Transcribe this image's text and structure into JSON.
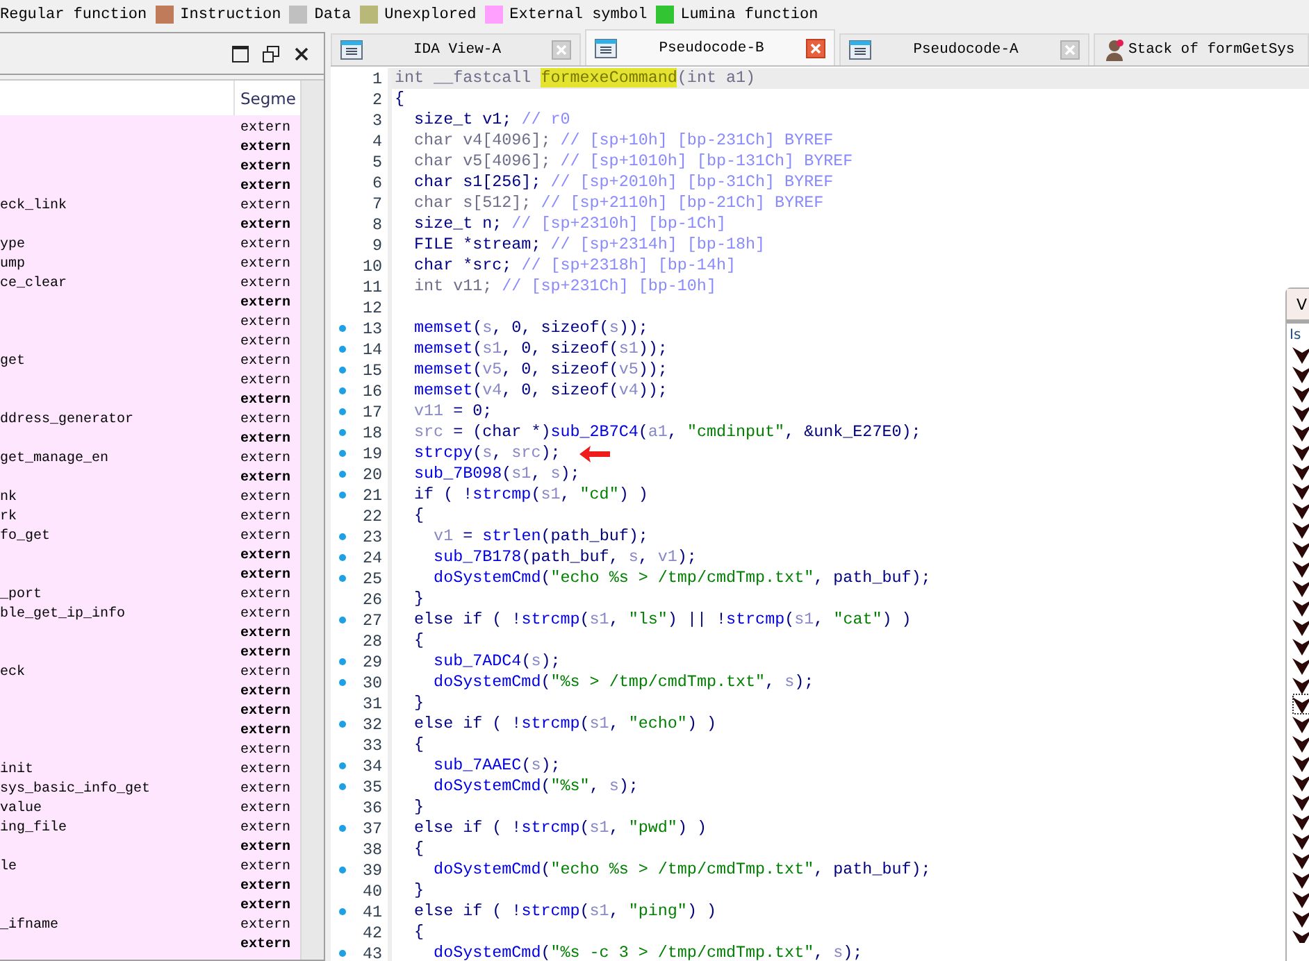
{
  "legend": [
    {
      "label": "Regular function"
    },
    {
      "label": "Instruction",
      "color": "#c07c5a"
    },
    {
      "label": "Data",
      "color": "#c0c0c0"
    },
    {
      "label": "Unexplored",
      "color": "#b8b878"
    },
    {
      "label": "External symbol",
      "color": "#ffa0ff"
    },
    {
      "label": "Lumina function",
      "color": "#33c433"
    }
  ],
  "functions_panel": {
    "columns": [
      "Segme"
    ],
    "rows": [
      {
        "segment": "extern",
        "bold": false
      },
      {
        "segment": "extern",
        "bold": true
      },
      {
        "segment": "extern",
        "bold": true
      },
      {
        "segment": "extern",
        "bold": true
      },
      {
        "name": "eck_link",
        "segment": "extern",
        "bold": false
      },
      {
        "segment": "extern",
        "bold": true
      },
      {
        "name": "ype",
        "segment": "extern",
        "bold": false
      },
      {
        "name": "ump",
        "segment": "extern",
        "bold": false
      },
      {
        "name": "ce_clear",
        "segment": "extern",
        "bold": false
      },
      {
        "segment": "extern",
        "bold": true
      },
      {
        "segment": "extern",
        "bold": false
      },
      {
        "segment": "extern",
        "bold": false
      },
      {
        "name": "get",
        "segment": "extern",
        "bold": false
      },
      {
        "segment": "extern",
        "bold": false
      },
      {
        "segment": "extern",
        "bold": true
      },
      {
        "name": "ddress_generator",
        "segment": "extern",
        "bold": false
      },
      {
        "segment": "extern",
        "bold": true
      },
      {
        "name": "get_manage_en",
        "segment": "extern",
        "bold": false
      },
      {
        "segment": "extern",
        "bold": true
      },
      {
        "name": "nk",
        "segment": "extern",
        "bold": false
      },
      {
        "name": "rk",
        "segment": "extern",
        "bold": false
      },
      {
        "name": "fo_get",
        "segment": "extern",
        "bold": false
      },
      {
        "segment": "extern",
        "bold": true
      },
      {
        "segment": "extern",
        "bold": true
      },
      {
        "name": "_port",
        "segment": "extern",
        "bold": false
      },
      {
        "name": "ble_get_ip_info",
        "segment": "extern",
        "bold": false
      },
      {
        "segment": "extern",
        "bold": true
      },
      {
        "segment": "extern",
        "bold": true
      },
      {
        "name": "eck",
        "segment": "extern",
        "bold": false
      },
      {
        "segment": "extern",
        "bold": true
      },
      {
        "segment": "extern",
        "bold": true
      },
      {
        "segment": "extern",
        "bold": true
      },
      {
        "segment": "extern",
        "bold": false
      },
      {
        "name": "init",
        "segment": "extern",
        "bold": false
      },
      {
        "name": "sys_basic_info_get",
        "segment": "extern",
        "bold": false
      },
      {
        "name": "value",
        "segment": "extern",
        "bold": false
      },
      {
        "name": "ing_file",
        "segment": "extern",
        "bold": false
      },
      {
        "segment": "extern",
        "bold": true
      },
      {
        "name": "le",
        "segment": "extern",
        "bold": false
      },
      {
        "segment": "extern",
        "bold": true
      },
      {
        "segment": "extern",
        "bold": true
      },
      {
        "name": "_ifname",
        "segment": "extern",
        "bold": false
      },
      {
        "segment": "extern",
        "bold": true
      }
    ]
  },
  "tabs": [
    {
      "label": "IDA View-A",
      "kind": "listing",
      "selected": false
    },
    {
      "label": "Pseudocode-B",
      "kind": "listing",
      "selected": true
    },
    {
      "label": "Pseudocode-A",
      "kind": "listing",
      "selected": false
    },
    {
      "label": "Stack of formGetSys",
      "kind": "avatar",
      "selected": false
    }
  ],
  "code": [
    {
      "number": "1",
      "dot": false,
      "current": true,
      "marked": false,
      "segs": [
        {
          "kind": "grey",
          "text": "int __fastcall "
        },
        {
          "kind": "highlight",
          "text": "formexeCommand"
        },
        {
          "kind": "grey",
          "text": "(int a1)"
        }
      ]
    },
    {
      "number": "2",
      "dot": false,
      "current": false,
      "marked": false,
      "segs": [
        {
          "kind": "plain",
          "text": "{"
        }
      ]
    },
    {
      "number": "3",
      "dot": false,
      "current": false,
      "marked": false,
      "segs": [
        {
          "kind": "plain",
          "text": "  size_t v1; "
        },
        {
          "kind": "comment",
          "text": "// r0"
        }
      ]
    },
    {
      "number": "4",
      "dot": false,
      "current": false,
      "marked": false,
      "segs": [
        {
          "kind": "grey",
          "text": "  char v4[4096]; "
        },
        {
          "kind": "comment",
          "text": "// [sp+10h] [bp-231Ch] BYREF"
        }
      ]
    },
    {
      "number": "5",
      "dot": false,
      "current": false,
      "marked": false,
      "segs": [
        {
          "kind": "grey",
          "text": "  char v5[4096]; "
        },
        {
          "kind": "comment",
          "text": "// [sp+1010h] [bp-131Ch] BYREF"
        }
      ]
    },
    {
      "number": "6",
      "dot": false,
      "current": false,
      "marked": false,
      "segs": [
        {
          "kind": "plain",
          "text": "  char s1[256]; "
        },
        {
          "kind": "comment",
          "text": "// [sp+2010h] [bp-31Ch] BYREF"
        }
      ]
    },
    {
      "number": "7",
      "dot": false,
      "current": false,
      "marked": false,
      "segs": [
        {
          "kind": "grey",
          "text": "  char s[512]; "
        },
        {
          "kind": "comment",
          "text": "// [sp+2110h] [bp-21Ch] BYREF"
        }
      ]
    },
    {
      "number": "8",
      "dot": false,
      "current": false,
      "marked": false,
      "segs": [
        {
          "kind": "plain",
          "text": "  size_t n; "
        },
        {
          "kind": "comment",
          "text": "// [sp+2310h] [bp-1Ch]"
        }
      ]
    },
    {
      "number": "9",
      "dot": false,
      "current": false,
      "marked": false,
      "segs": [
        {
          "kind": "plain",
          "text": "  FILE *stream; "
        },
        {
          "kind": "comment",
          "text": "// [sp+2314h] [bp-18h]"
        }
      ]
    },
    {
      "number": "10",
      "dot": false,
      "current": false,
      "marked": false,
      "segs": [
        {
          "kind": "plain",
          "text": "  char *src; "
        },
        {
          "kind": "comment",
          "text": "// [sp+2318h] [bp-14h]"
        }
      ]
    },
    {
      "number": "11",
      "dot": false,
      "current": false,
      "marked": false,
      "segs": [
        {
          "kind": "grey",
          "text": "  int v11; "
        },
        {
          "kind": "comment",
          "text": "// [sp+231Ch] [bp-10h]"
        }
      ]
    },
    {
      "number": "12",
      "dot": false,
      "current": false,
      "marked": false
    },
    {
      "number": "13",
      "dot": true,
      "current": false,
      "marked": false,
      "segs": [
        {
          "kind": "func",
          "text": "  memset"
        },
        {
          "kind": "plain",
          "text": "("
        },
        {
          "kind": "variable",
          "text": "s"
        },
        {
          "kind": "plain",
          "text": ", 0, sizeof("
        },
        {
          "kind": "variable",
          "text": "s"
        },
        {
          "kind": "plain",
          "text": "));"
        }
      ]
    },
    {
      "number": "14",
      "dot": true,
      "current": false,
      "marked": false,
      "segs": [
        {
          "kind": "func",
          "text": "  memset"
        },
        {
          "kind": "plain",
          "text": "("
        },
        {
          "kind": "variable",
          "text": "s1"
        },
        {
          "kind": "plain",
          "text": ", 0, sizeof("
        },
        {
          "kind": "variable",
          "text": "s1"
        },
        {
          "kind": "plain",
          "text": "));"
        }
      ]
    },
    {
      "number": "15",
      "dot": true,
      "current": false,
      "marked": false,
      "segs": [
        {
          "kind": "func",
          "text": "  memset"
        },
        {
          "kind": "plain",
          "text": "("
        },
        {
          "kind": "variable",
          "text": "v5"
        },
        {
          "kind": "plain",
          "text": ", 0, sizeof("
        },
        {
          "kind": "variable",
          "text": "v5"
        },
        {
          "kind": "plain",
          "text": "));"
        }
      ]
    },
    {
      "number": "16",
      "dot": true,
      "current": false,
      "marked": false,
      "segs": [
        {
          "kind": "func",
          "text": "  memset"
        },
        {
          "kind": "plain",
          "text": "("
        },
        {
          "kind": "variable",
          "text": "v4"
        },
        {
          "kind": "plain",
          "text": ", 0, sizeof("
        },
        {
          "kind": "variable",
          "text": "v4"
        },
        {
          "kind": "plain",
          "text": "));"
        }
      ]
    },
    {
      "number": "17",
      "dot": true,
      "current": false,
      "marked": false,
      "segs": [
        {
          "kind": "variable",
          "text": "  v11"
        },
        {
          "kind": "plain",
          "text": " = 0;"
        }
      ]
    },
    {
      "number": "18",
      "dot": true,
      "current": false,
      "marked": false,
      "segs": [
        {
          "kind": "variable",
          "text": "  src"
        },
        {
          "kind": "plain",
          "text": " = (char *)"
        },
        {
          "kind": "func",
          "text": "sub_2B7C4"
        },
        {
          "kind": "plain",
          "text": "("
        },
        {
          "kind": "variable",
          "text": "a1"
        },
        {
          "kind": "plain",
          "text": ", "
        },
        {
          "kind": "string",
          "text": "\"cmdinput\""
        },
        {
          "kind": "plain",
          "text": ", &unk_E27E0);"
        }
      ]
    },
    {
      "number": "19",
      "dot": true,
      "current": false,
      "marked": true,
      "segs": [
        {
          "kind": "func",
          "text": "  strcpy"
        },
        {
          "kind": "plain",
          "text": "("
        },
        {
          "kind": "variable",
          "text": "s"
        },
        {
          "kind": "plain",
          "text": ", "
        },
        {
          "kind": "variable",
          "text": "src"
        },
        {
          "kind": "plain",
          "text": ");"
        }
      ]
    },
    {
      "number": "20",
      "dot": true,
      "current": false,
      "marked": false,
      "segs": [
        {
          "kind": "func",
          "text": "  sub_7B098"
        },
        {
          "kind": "plain",
          "text": "("
        },
        {
          "kind": "variable",
          "text": "s1"
        },
        {
          "kind": "plain",
          "text": ", "
        },
        {
          "kind": "variable",
          "text": "s"
        },
        {
          "kind": "plain",
          "text": ");"
        }
      ]
    },
    {
      "number": "21",
      "dot": true,
      "current": false,
      "marked": false,
      "segs": [
        {
          "kind": "plain",
          "text": "  if ( !"
        },
        {
          "kind": "func",
          "text": "strcmp"
        },
        {
          "kind": "plain",
          "text": "("
        },
        {
          "kind": "variable",
          "text": "s1"
        },
        {
          "kind": "plain",
          "text": ", "
        },
        {
          "kind": "string",
          "text": "\"cd\""
        },
        {
          "kind": "plain",
          "text": ") )"
        }
      ]
    },
    {
      "number": "22",
      "dot": false,
      "current": false,
      "marked": false,
      "segs": [
        {
          "kind": "plain",
          "text": "  {"
        }
      ]
    },
    {
      "number": "23",
      "dot": true,
      "current": false,
      "marked": false,
      "segs": [
        {
          "kind": "variable",
          "text": "    v1"
        },
        {
          "kind": "plain",
          "text": " = "
        },
        {
          "kind": "func",
          "text": "strlen"
        },
        {
          "kind": "plain",
          "text": "(path_buf);"
        }
      ]
    },
    {
      "number": "24",
      "dot": true,
      "current": false,
      "marked": false,
      "segs": [
        {
          "kind": "func",
          "text": "    sub_7B178"
        },
        {
          "kind": "plain",
          "text": "(path_buf, "
        },
        {
          "kind": "variable",
          "text": "s"
        },
        {
          "kind": "plain",
          "text": ", "
        },
        {
          "kind": "variable",
          "text": "v1"
        },
        {
          "kind": "plain",
          "text": ");"
        }
      ]
    },
    {
      "number": "25",
      "dot": true,
      "current": false,
      "marked": false,
      "segs": [
        {
          "kind": "func",
          "text": "    doSystemCmd"
        },
        {
          "kind": "plain",
          "text": "("
        },
        {
          "kind": "string",
          "text": "\"echo %s > /tmp/cmdTmp.txt\""
        },
        {
          "kind": "plain",
          "text": ", path_buf);"
        }
      ]
    },
    {
      "number": "26",
      "dot": false,
      "current": false,
      "marked": false,
      "segs": [
        {
          "kind": "plain",
          "text": "  }"
        }
      ]
    },
    {
      "number": "27",
      "dot": true,
      "current": false,
      "marked": false,
      "segs": [
        {
          "kind": "plain",
          "text": "  else if ( !"
        },
        {
          "kind": "func",
          "text": "strcmp"
        },
        {
          "kind": "plain",
          "text": "("
        },
        {
          "kind": "variable",
          "text": "s1"
        },
        {
          "kind": "plain",
          "text": ", "
        },
        {
          "kind": "string",
          "text": "\"ls\""
        },
        {
          "kind": "plain",
          "text": ") || !"
        },
        {
          "kind": "func",
          "text": "strcmp"
        },
        {
          "kind": "plain",
          "text": "("
        },
        {
          "kind": "variable",
          "text": "s1"
        },
        {
          "kind": "plain",
          "text": ", "
        },
        {
          "kind": "string",
          "text": "\"cat\""
        },
        {
          "kind": "plain",
          "text": ") )"
        }
      ]
    },
    {
      "number": "28",
      "dot": false,
      "current": false,
      "marked": false,
      "segs": [
        {
          "kind": "plain",
          "text": "  {"
        }
      ]
    },
    {
      "number": "29",
      "dot": true,
      "current": false,
      "marked": false,
      "segs": [
        {
          "kind": "func",
          "text": "    sub_7ADC4"
        },
        {
          "kind": "plain",
          "text": "("
        },
        {
          "kind": "variable",
          "text": "s"
        },
        {
          "kind": "plain",
          "text": ");"
        }
      ]
    },
    {
      "number": "30",
      "dot": true,
      "current": false,
      "marked": false,
      "segs": [
        {
          "kind": "func",
          "text": "    doSystemCmd"
        },
        {
          "kind": "plain",
          "text": "("
        },
        {
          "kind": "string",
          "text": "\"%s > /tmp/cmdTmp.txt\""
        },
        {
          "kind": "plain",
          "text": ", "
        },
        {
          "kind": "variable",
          "text": "s"
        },
        {
          "kind": "plain",
          "text": ");"
        }
      ]
    },
    {
      "number": "31",
      "dot": false,
      "current": false,
      "marked": false,
      "segs": [
        {
          "kind": "plain",
          "text": "  }"
        }
      ]
    },
    {
      "number": "32",
      "dot": true,
      "current": false,
      "marked": false,
      "segs": [
        {
          "kind": "plain",
          "text": "  else if ( !"
        },
        {
          "kind": "func",
          "text": "strcmp"
        },
        {
          "kind": "plain",
          "text": "("
        },
        {
          "kind": "variable",
          "text": "s1"
        },
        {
          "kind": "plain",
          "text": ", "
        },
        {
          "kind": "string",
          "text": "\"echo\""
        },
        {
          "kind": "plain",
          "text": ") )"
        }
      ]
    },
    {
      "number": "33",
      "dot": false,
      "current": false,
      "marked": false,
      "segs": [
        {
          "kind": "plain",
          "text": "  {"
        }
      ]
    },
    {
      "number": "34",
      "dot": true,
      "current": false,
      "marked": false,
      "segs": [
        {
          "kind": "func",
          "text": "    sub_7AAEC"
        },
        {
          "kind": "plain",
          "text": "("
        },
        {
          "kind": "variable",
          "text": "s"
        },
        {
          "kind": "plain",
          "text": ");"
        }
      ]
    },
    {
      "number": "35",
      "dot": true,
      "current": false,
      "marked": false,
      "segs": [
        {
          "kind": "func",
          "text": "    doSystemCmd"
        },
        {
          "kind": "plain",
          "text": "("
        },
        {
          "kind": "string",
          "text": "\"%s\""
        },
        {
          "kind": "plain",
          "text": ", "
        },
        {
          "kind": "variable",
          "text": "s"
        },
        {
          "kind": "plain",
          "text": ");"
        }
      ]
    },
    {
      "number": "36",
      "dot": false,
      "current": false,
      "marked": false,
      "segs": [
        {
          "kind": "plain",
          "text": "  }"
        }
      ]
    },
    {
      "number": "37",
      "dot": true,
      "current": false,
      "marked": false,
      "segs": [
        {
          "kind": "plain",
          "text": "  else if ( !"
        },
        {
          "kind": "func",
          "text": "strcmp"
        },
        {
          "kind": "plain",
          "text": "("
        },
        {
          "kind": "variable",
          "text": "s1"
        },
        {
          "kind": "plain",
          "text": ", "
        },
        {
          "kind": "string",
          "text": "\"pwd\""
        },
        {
          "kind": "plain",
          "text": ") )"
        }
      ]
    },
    {
      "number": "38",
      "dot": false,
      "current": false,
      "marked": false,
      "segs": [
        {
          "kind": "plain",
          "text": "  {"
        }
      ]
    },
    {
      "number": "39",
      "dot": true,
      "current": false,
      "marked": false,
      "segs": [
        {
          "kind": "func",
          "text": "    doSystemCmd"
        },
        {
          "kind": "plain",
          "text": "("
        },
        {
          "kind": "string",
          "text": "\"echo %s > /tmp/cmdTmp.txt\""
        },
        {
          "kind": "plain",
          "text": ", path_buf);"
        }
      ]
    },
    {
      "number": "40",
      "dot": false,
      "current": false,
      "marked": false,
      "segs": [
        {
          "kind": "plain",
          "text": "  }"
        }
      ]
    },
    {
      "number": "41",
      "dot": true,
      "current": false,
      "marked": false,
      "segs": [
        {
          "kind": "plain",
          "text": "  else if ( !"
        },
        {
          "kind": "func",
          "text": "strcmp"
        },
        {
          "kind": "plain",
          "text": "("
        },
        {
          "kind": "variable",
          "text": "s1"
        },
        {
          "kind": "plain",
          "text": ", "
        },
        {
          "kind": "string",
          "text": "\"ping\""
        },
        {
          "kind": "plain",
          "text": ") )"
        }
      ]
    },
    {
      "number": "42",
      "dot": false,
      "current": false,
      "marked": false,
      "segs": [
        {
          "kind": "plain",
          "text": "  {"
        }
      ]
    },
    {
      "number": "43",
      "dot": true,
      "current": false,
      "marked": false,
      "segs": [
        {
          "kind": "func",
          "text": "    doSystemCmd"
        },
        {
          "kind": "plain",
          "text": "("
        },
        {
          "kind": "string",
          "text": "\"%s -c 3 > /tmp/cmdTmp.txt\""
        },
        {
          "kind": "plain",
          "text": ", "
        },
        {
          "kind": "variable",
          "text": "s"
        },
        {
          "kind": "plain",
          "text": ");"
        }
      ]
    }
  ],
  "side_window": {
    "tab": "V",
    "label": "Is"
  }
}
